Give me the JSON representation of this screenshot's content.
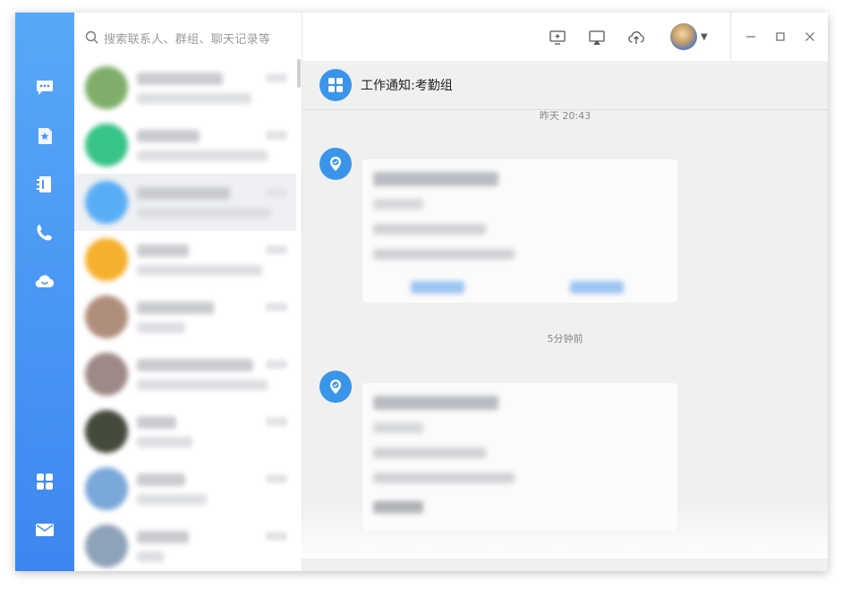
{
  "search": {
    "placeholder": "搜索联系人、群组、聊天记录等"
  },
  "rail": {
    "items": [
      {
        "icon": "chat-icon"
      },
      {
        "icon": "star-document-icon"
      },
      {
        "icon": "contacts-book-icon"
      },
      {
        "icon": "phone-icon"
      },
      {
        "icon": "cloud-smile-icon"
      }
    ],
    "bottom": [
      {
        "icon": "apps-grid-icon"
      },
      {
        "icon": "mail-icon"
      }
    ]
  },
  "conversations": [
    {
      "avatar_color": "#7fae6b",
      "active": false
    },
    {
      "avatar_color": "#38c387",
      "active": false
    },
    {
      "avatar_color": "#58aef5",
      "active": true
    },
    {
      "avatar_color": "#f5b02e",
      "active": false
    },
    {
      "avatar_color": "#b08e7c",
      "active": false
    },
    {
      "avatar_color": "#9d8a86",
      "active": false
    },
    {
      "avatar_color": "#444a3c",
      "active": false
    },
    {
      "avatar_color": "#7aa8d8",
      "active": false
    },
    {
      "avatar_color": "#8ea2b8",
      "active": false
    }
  ],
  "toolbar": {
    "icons": [
      "screen-add-icon",
      "airplay-icon",
      "cloud-upload-icon",
      "user-avatar",
      "dropdown-caret-icon"
    ]
  },
  "window_controls": [
    "minimize-icon",
    "maximize-icon",
    "close-icon"
  ],
  "chat": {
    "title": "工作通知:考勤组",
    "timestamps": [
      "昨天 20:43",
      "5分钟前"
    ]
  },
  "colors": {
    "accent": "#3a95ea",
    "rail_top": "#58a8f8",
    "rail_bottom": "#3d86f0"
  }
}
